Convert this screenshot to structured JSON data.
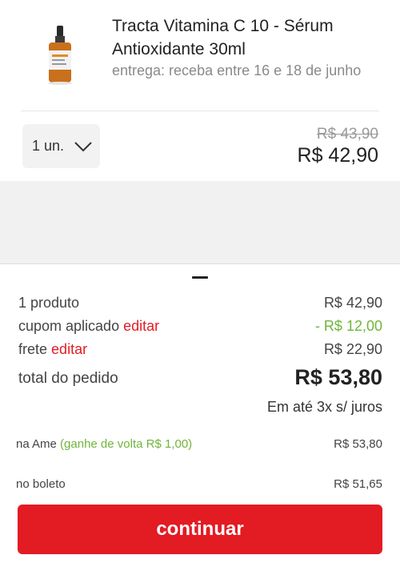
{
  "product": {
    "title": "Tracta Vitamina C 10 - Sérum Antioxidante 30ml",
    "delivery": "entrega: receba entre 16 e 18 de junho",
    "quantity": "1 un.",
    "price_original": "R$ 43,90",
    "price_current": "R$ 42,90"
  },
  "summary": {
    "products_label": "1 produto",
    "products_value": "R$ 42,90",
    "coupon_label": "cupom aplicado",
    "coupon_edit": "editar",
    "coupon_value": "- R$ 12,00",
    "shipping_label": "frete",
    "shipping_edit": "editar",
    "shipping_value": "R$ 22,90",
    "total_label": "total do pedido",
    "total_value": "R$ 53,80",
    "installments": "Em até 3x s/ juros"
  },
  "payment_options": {
    "ame_label": "na Ame",
    "ame_cashback": "(ganhe de volta R$ 1,00)",
    "ame_value": "R$ 53,80",
    "boleto_label": "no boleto",
    "boleto_value": "R$ 51,65"
  },
  "actions": {
    "continue_label": "continuar"
  },
  "colors": {
    "accent": "#e31b23",
    "cashback_green": "#6fb53a",
    "product_cap": "#222222",
    "product_bottle": "#c9701c"
  },
  "icons": {
    "quantity_dropdown": "chevron-down-icon",
    "product_image": "serum-bottle-icon"
  }
}
